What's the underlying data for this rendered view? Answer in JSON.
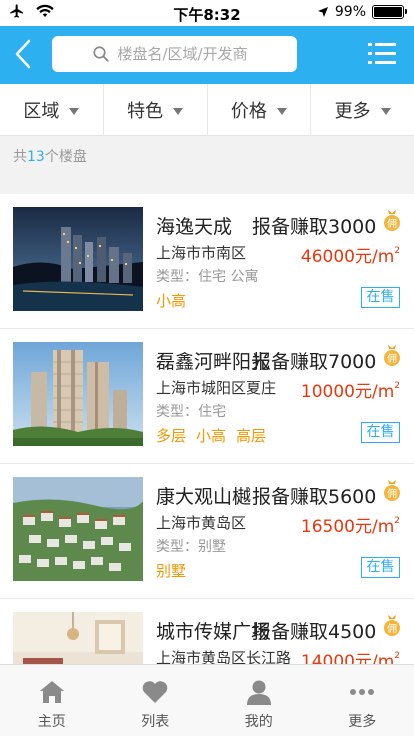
{
  "status_bar": {
    "time": "下午8:32",
    "battery_text": "99%",
    "battery_level": 0.99
  },
  "header": {
    "search_placeholder": "楼盘名/区域/开发商"
  },
  "filters": [
    {
      "label": "区域"
    },
    {
      "label": "特色"
    },
    {
      "label": "价格"
    },
    {
      "label": "更多"
    }
  ],
  "count": {
    "prefix": "共",
    "number": "13",
    "suffix": "个楼盘"
  },
  "listings": [
    {
      "title": "海逸天成",
      "commission": "报备赚取3000",
      "area": "上海市市南区",
      "price": "46000元/m",
      "price_sup": "2",
      "type": "类型：住宅 公寓",
      "tags": [
        "小高"
      ],
      "status": "在售"
    },
    {
      "title": "磊鑫河畔阳光",
      "commission": "报备赚取7000",
      "area": "上海市城阳区夏庄",
      "price": "10000元/m",
      "price_sup": "2",
      "type": "类型：住宅",
      "tags": [
        "多层",
        "小高",
        "高层"
      ],
      "status": "在售"
    },
    {
      "title": "康大观山樾",
      "commission": "报备赚取5600",
      "area": "上海市黄岛区",
      "price": "16500元/m",
      "price_sup": "2",
      "type": "类型：别墅",
      "tags": [
        "别墅"
      ],
      "status": "在售"
    },
    {
      "title": "城市传媒广场",
      "commission": "报备赚取4500",
      "area": "上海市黄岛区长江路",
      "price": "14000元/m",
      "price_sup": "2",
      "type": "",
      "tags": [],
      "status": ""
    }
  ],
  "coin_glyph": "佣",
  "tabs": [
    {
      "label": "主页",
      "icon": "home-icon"
    },
    {
      "label": "列表",
      "icon": "heart-icon"
    },
    {
      "label": "我的",
      "icon": "user-icon"
    },
    {
      "label": "更多",
      "icon": "more-icon"
    }
  ],
  "colors": {
    "accent": "#2cb0f0",
    "price": "#e8380d",
    "tag": "#f39800"
  }
}
